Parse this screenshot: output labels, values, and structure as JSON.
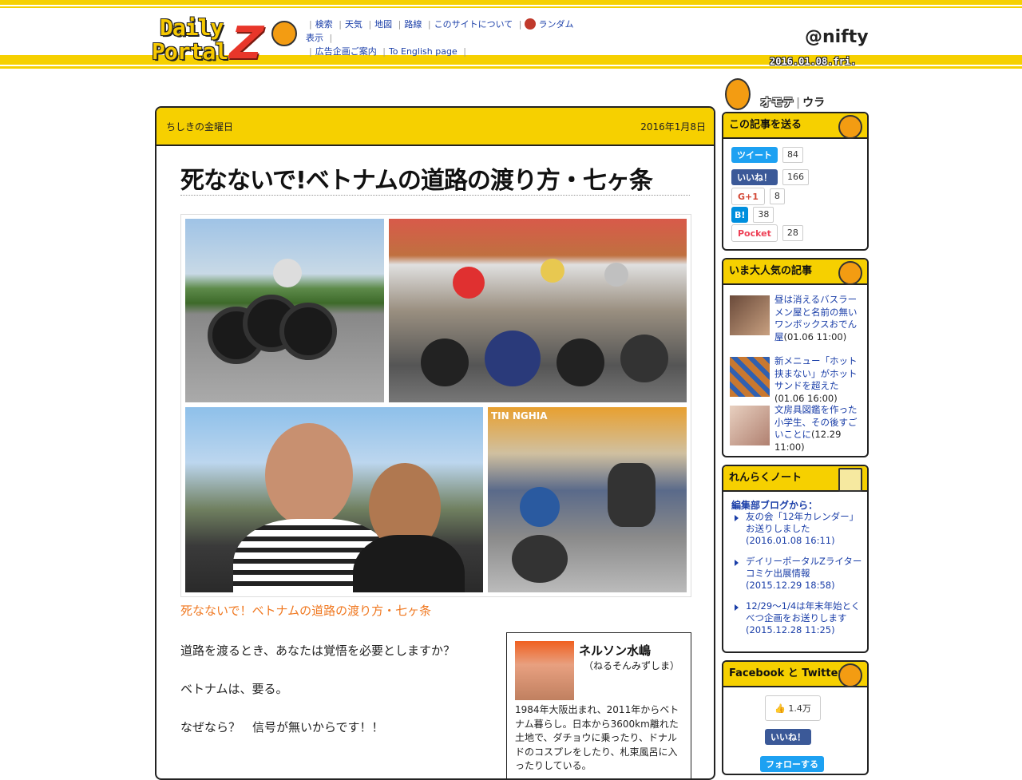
{
  "header": {
    "logo_line1": "Daily",
    "logo_line2": "Portal",
    "logo_z": "Z",
    "nav_row1": [
      "検索",
      "天気",
      "地図",
      "路線",
      "このサイトについて",
      "ランダム表示"
    ],
    "nav_row2": [
      "広告企画ご案内",
      "To English page"
    ],
    "brand": "@nifty",
    "date_badge": "2016.01.08.fri."
  },
  "article": {
    "series": "ちしきの金曜日",
    "date": "2016年1月8日",
    "title": "死なないで!ベトナムの道路の渡り方・七ヶ条",
    "caption": "死なないで！ベトナムの道路の渡り方・七ヶ条",
    "paragraphs": [
      "道路を渡るとき、あなたは覚悟を必要としますか？",
      "ベトナムは、要る。",
      "なぜなら？　信号が無いからです！！"
    ]
  },
  "author": {
    "name": "ネルソン水嶋",
    "kana": "（ねるそんみずしま）",
    "bio": "1984年大阪出まれ、2011年からベトナム暮らし。日本から3600km離れた土地で、ダチョウに乗ったり、ドナルドのコスプレをしたり、札束風呂に入ったりしている。"
  },
  "sidebar": {
    "omote": "オモテ",
    "ura": "ウラ",
    "share_title": "この記事を送る",
    "share": [
      {
        "label": "ツイート",
        "count": "84"
      },
      {
        "label": "いいね！",
        "count": "166"
      },
      {
        "label": "G+1",
        "count": "8"
      },
      {
        "label": "B!",
        "count": "38"
      },
      {
        "label": "Pocket",
        "count": "28"
      }
    ],
    "popular_title": "いま大人気の記事",
    "popular": [
      {
        "title": "昼は消えるバスラーメン屋と名前の無いワンボックスおでん屋",
        "date": "(01.06 11:00)"
      },
      {
        "title": "新メニュー「ホット挟まない」がホットサンドを超えた",
        "date": "(01.06 16:00)"
      },
      {
        "title": "文房具図鑑を作った小学生、その後すごいことに",
        "date": "(12.29 11:00)"
      }
    ],
    "renraku_title": "れんらくノート",
    "renraku_label": "編集部ブログから：",
    "renraku": [
      {
        "title": "友の会「12年カレンダー」お送りしました",
        "date": "(2016.01.08 16:11)"
      },
      {
        "title": "デイリーポータルZライター コミケ出展情報",
        "date": "(2015.12.29 18:58)"
      },
      {
        "title": "12/29〜1/4は年末年始とくべつ企画をお送りします",
        "date": "(2015.12.28 11:25)"
      }
    ],
    "social_title": "Facebook と Twitter",
    "fb_count": "1.4万",
    "fb_like": "いいね！",
    "tw_follow": "フォローする"
  }
}
